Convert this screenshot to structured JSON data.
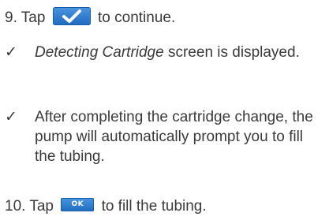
{
  "steps": [
    {
      "number": "9.",
      "before": "Tap",
      "icon": "checkmark-button-icon",
      "after": "to continue."
    },
    {
      "number": "10.",
      "before": "Tap",
      "icon_label": "OK",
      "after": "to fill the tubing."
    }
  ],
  "results": [
    {
      "mark": "✓",
      "italic": "Detecting Cartridge",
      "rest": " screen is displayed."
    },
    {
      "mark": "✓",
      "text": "After completing the cartridge change, the pump will automatically prompt you to fill the tubing."
    }
  ],
  "colors": {
    "text": "#3a3a3a",
    "button_blue": "#2a7ad0"
  }
}
